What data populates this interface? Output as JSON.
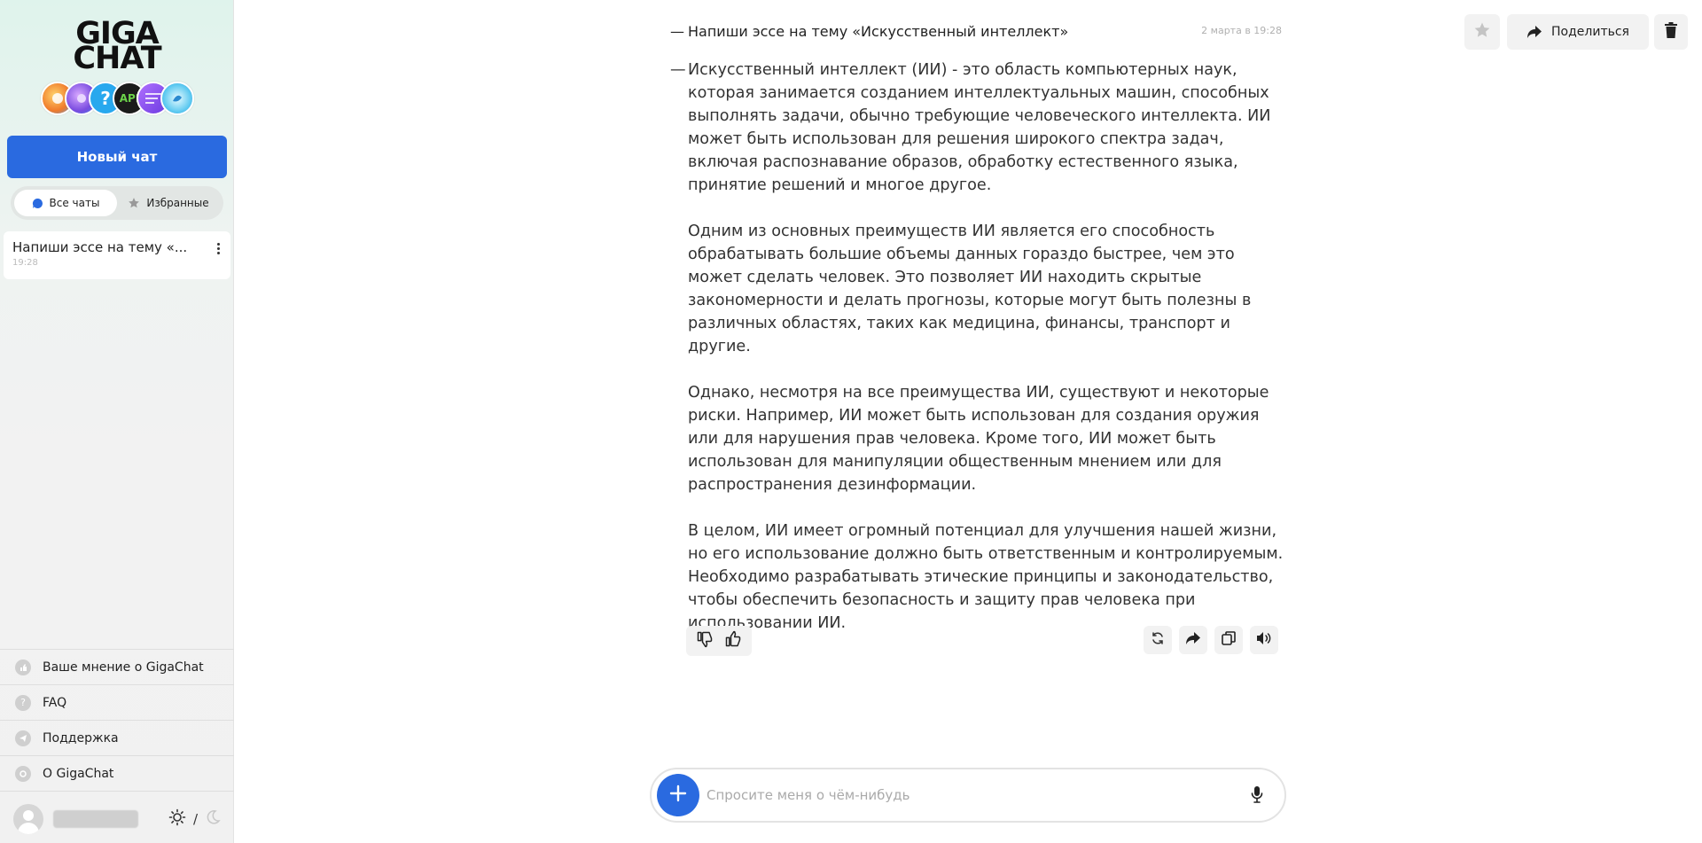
{
  "sidebar": {
    "logo_line1": "GIGA",
    "logo_line2": "CHAT",
    "badges": [
      {
        "name": "badge-1",
        "glyph": "",
        "color": "#f0a040"
      },
      {
        "name": "badge-2",
        "glyph": "",
        "color": "#8a5cf0"
      },
      {
        "name": "badge-3",
        "glyph": "?",
        "color": "#2aa8f0"
      },
      {
        "name": "badge-4",
        "glyph": "API",
        "color": "#1a1a1a"
      },
      {
        "name": "badge-5",
        "glyph": "",
        "color": "#a05cf0"
      },
      {
        "name": "badge-6",
        "glyph": "",
        "color": "#3ab0f0"
      }
    ],
    "new_chat_label": "Новый чат",
    "tab_all_label": "Все чаты",
    "tab_favorites_label": "Избранные",
    "chats": [
      {
        "title": "Напиши эссе на тему «...",
        "time": "19:28"
      }
    ],
    "links": [
      {
        "label": "Ваше мнение о GigaChat",
        "icon": "feedback-icon"
      },
      {
        "label": "FAQ",
        "icon": "question-icon"
      },
      {
        "label": "Поддержка",
        "icon": "telegram-icon"
      },
      {
        "label": "О GigaChat",
        "icon": "gigachat-icon"
      }
    ],
    "theme_separator": "/"
  },
  "header": {
    "share_label": "Поделиться"
  },
  "conversation": {
    "question": "Напиши эссе на тему «Искусственный интеллект»",
    "question_date": "2 марта в 19:28",
    "dash": "—",
    "answer_paragraphs": [
      "Искусственный интеллект (ИИ) - это область компьютерных наук, которая занимается созданием интеллектуальных машин, способных выполнять задачи, обычно требующие человеческого интеллекта. ИИ может быть использован для решения широкого спектра задач, включая распознавание образов, обработку естественного языка, принятие решений и многое другое.",
      "Одним из основных преимуществ ИИ является его способность обрабатывать большие объемы данных гораздо быстрее, чем это может сделать человек. Это позволяет ИИ находить скрытые закономерности и делать прогнозы, которые могут быть полезны в различных областях, таких как медицина, финансы, транспорт и другие.",
      "Однако, несмотря на все преимущества ИИ, существуют и некоторые риски. Например, ИИ может быть использован для создания оружия или для нарушения прав человека. Кроме того, ИИ может быть использован для манипуляции общественным мнением или для распространения дезинформации.",
      "В целом, ИИ имеет огромный потенциал для улучшения нашей жизни, но его использование должно быть ответственным и контролируемым. Необходимо разрабатывать этические принципы и законодательство, чтобы обеспечить безопасность и защиту прав человека при использовании ИИ."
    ]
  },
  "composer": {
    "placeholder": "Спросите меня о чём-нибудь",
    "value": ""
  },
  "colors": {
    "accent": "#2a6ae0",
    "button_bg": "#f2f2f2"
  }
}
